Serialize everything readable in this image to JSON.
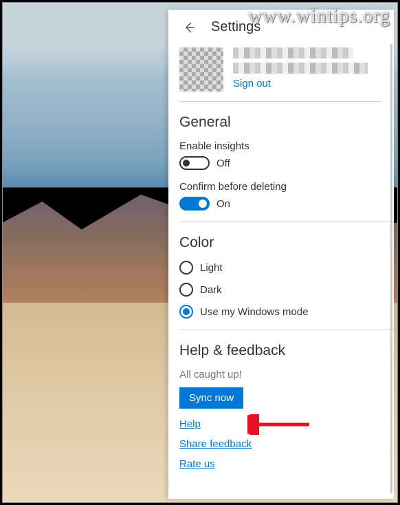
{
  "watermark": "www.wintips.org",
  "header": {
    "title": "Settings"
  },
  "account": {
    "signout": "Sign out"
  },
  "general": {
    "title": "General",
    "insights_label": "Enable insights",
    "insights_state": "Off",
    "confirm_label": "Confirm before deleting",
    "confirm_state": "On"
  },
  "color": {
    "title": "Color",
    "options": {
      "light": "Light",
      "dark": "Dark",
      "windows": "Use my Windows mode"
    }
  },
  "help": {
    "title": "Help & feedback",
    "caught_up": "All caught up!",
    "sync": "Sync now",
    "help_link": "Help",
    "feedback_link": "Share feedback",
    "rate_link": "Rate us"
  }
}
